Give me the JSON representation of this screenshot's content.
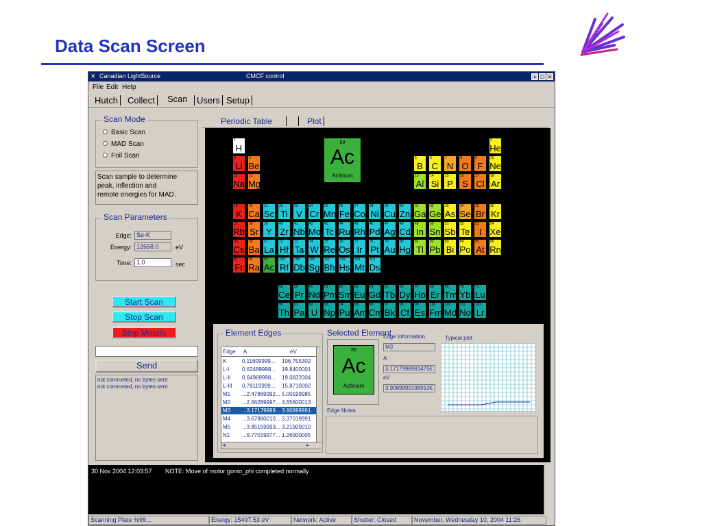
{
  "slide": {
    "title": "Data Scan Screen"
  },
  "window": {
    "app_name": "Canadian LightSource",
    "title": "CMCF control",
    "buttons": [
      "▪",
      "□",
      "×"
    ]
  },
  "menu": [
    "File",
    "Edit",
    "Help"
  ],
  "tabs": [
    "Hutch",
    "Collect",
    "Scan",
    "Users",
    "Setup"
  ],
  "scan_mode": {
    "label": "Scan Mode",
    "options": [
      "Basic Scan",
      "MAD Scan",
      "Foil Scan"
    ],
    "description": [
      "Scan sample to determine",
      "peak, inflection and",
      "remote energies for MAD."
    ]
  },
  "scan_params": {
    "label": "Scan Parameters",
    "edge_label": "Edge:",
    "edge_value": "Se-K",
    "energy_label": "Energy:",
    "energy_value": "12658.0",
    "energy_unit": "eV",
    "time_label": "Time:",
    "time_value": "1.0",
    "time_unit": "sec"
  },
  "actions": {
    "start": "Start Scan",
    "stop": "Stop Scan",
    "stop_motors": "Stop Motors",
    "send": "Send"
  },
  "command_input": "",
  "log": [
    "not connceted, no bytes sent",
    "not connceted, no bytes sent"
  ],
  "periodic_tabs": [
    "Periodic Table",
    "Plot"
  ],
  "selected_big": {
    "number": "89",
    "symbol": "Ac",
    "name": "Actinium"
  },
  "colors": {
    "white": "#ffffff",
    "red": "#e8211a",
    "orange": "#f07a1c",
    "lorange": "#f5a623",
    "yellow": "#f8f01e",
    "lgreen": "#9fe02a",
    "green": "#3cb03c",
    "cyan": "#22c8d8",
    "teal": "#12a8a0",
    "title_blue": "#2233bb"
  },
  "elements": [
    {
      "n": "1",
      "s": "H",
      "c": "white"
    },
    {
      "n": "2",
      "s": "He",
      "c": "yellow"
    },
    {
      "n": "3",
      "s": "Li",
      "c": "red"
    },
    {
      "n": "4",
      "s": "Be",
      "c": "orange"
    },
    {
      "n": "5",
      "s": "B",
      "c": "yellow"
    },
    {
      "n": "6",
      "s": "C",
      "c": "yellow"
    },
    {
      "n": "7",
      "s": "N",
      "c": "lorange"
    },
    {
      "n": "8",
      "s": "O",
      "c": "orange"
    },
    {
      "n": "9",
      "s": "F",
      "c": "orange"
    },
    {
      "n": "10",
      "s": "Ne",
      "c": "yellow"
    },
    {
      "n": "11",
      "s": "Na",
      "c": "red"
    },
    {
      "n": "12",
      "s": "Mg",
      "c": "orange"
    },
    {
      "n": "13",
      "s": "Al",
      "c": "lgreen"
    },
    {
      "n": "14",
      "s": "Si",
      "c": "yellow"
    },
    {
      "n": "15",
      "s": "P",
      "c": "yellow"
    },
    {
      "n": "16",
      "s": "S",
      "c": "orange"
    },
    {
      "n": "17",
      "s": "Cl",
      "c": "orange"
    },
    {
      "n": "18",
      "s": "Ar",
      "c": "yellow"
    },
    {
      "n": "19",
      "s": "K",
      "c": "red"
    },
    {
      "n": "20",
      "s": "Ca",
      "c": "orange"
    },
    {
      "n": "21",
      "s": "Sc",
      "c": "cyan"
    },
    {
      "n": "22",
      "s": "Ti",
      "c": "cyan"
    },
    {
      "n": "23",
      "s": "V",
      "c": "cyan"
    },
    {
      "n": "24",
      "s": "Cr",
      "c": "cyan"
    },
    {
      "n": "25",
      "s": "Mn",
      "c": "cyan"
    },
    {
      "n": "26",
      "s": "Fe",
      "c": "cyan"
    },
    {
      "n": "27",
      "s": "Co",
      "c": "cyan"
    },
    {
      "n": "28",
      "s": "Ni",
      "c": "cyan"
    },
    {
      "n": "29",
      "s": "Cu",
      "c": "cyan"
    },
    {
      "n": "30",
      "s": "Zn",
      "c": "cyan"
    },
    {
      "n": "31",
      "s": "Ga",
      "c": "lgreen"
    },
    {
      "n": "32",
      "s": "Ge",
      "c": "lgreen"
    },
    {
      "n": "33",
      "s": "As",
      "c": "yellow"
    },
    {
      "n": "34",
      "s": "Se",
      "c": "lorange"
    },
    {
      "n": "35",
      "s": "Br",
      "c": "orange"
    },
    {
      "n": "36",
      "s": "Kr",
      "c": "yellow"
    },
    {
      "n": "37",
      "s": "Rb",
      "c": "red"
    },
    {
      "n": "38",
      "s": "Sr",
      "c": "orange"
    },
    {
      "n": "39",
      "s": "Y",
      "c": "cyan"
    },
    {
      "n": "40",
      "s": "Zr",
      "c": "cyan"
    },
    {
      "n": "41",
      "s": "Nb",
      "c": "cyan"
    },
    {
      "n": "42",
      "s": "Mo",
      "c": "cyan"
    },
    {
      "n": "43",
      "s": "Tc",
      "c": "cyan"
    },
    {
      "n": "44",
      "s": "Ru",
      "c": "cyan"
    },
    {
      "n": "45",
      "s": "Rh",
      "c": "cyan"
    },
    {
      "n": "46",
      "s": "Pd",
      "c": "cyan"
    },
    {
      "n": "47",
      "s": "Ag",
      "c": "cyan"
    },
    {
      "n": "48",
      "s": "Cd",
      "c": "cyan"
    },
    {
      "n": "49",
      "s": "In",
      "c": "lgreen"
    },
    {
      "n": "50",
      "s": "Sn",
      "c": "lgreen"
    },
    {
      "n": "51",
      "s": "Sb",
      "c": "yellow"
    },
    {
      "n": "52",
      "s": "Te",
      "c": "yellow"
    },
    {
      "n": "53",
      "s": "I",
      "c": "orange"
    },
    {
      "n": "54",
      "s": "Xe",
      "c": "yellow"
    },
    {
      "n": "55",
      "s": "Cs",
      "c": "red"
    },
    {
      "n": "56",
      "s": "Ba",
      "c": "orange"
    },
    {
      "n": "57",
      "s": "La",
      "c": "cyan"
    },
    {
      "n": "72",
      "s": "Hf",
      "c": "cyan"
    },
    {
      "n": "73",
      "s": "Ta",
      "c": "cyan"
    },
    {
      "n": "74",
      "s": "W",
      "c": "cyan"
    },
    {
      "n": "75",
      "s": "Re",
      "c": "cyan"
    },
    {
      "n": "76",
      "s": "Os",
      "c": "cyan"
    },
    {
      "n": "77",
      "s": "Ir",
      "c": "cyan"
    },
    {
      "n": "78",
      "s": "Pt",
      "c": "cyan"
    },
    {
      "n": "79",
      "s": "Au",
      "c": "cyan"
    },
    {
      "n": "80",
      "s": "Hg",
      "c": "cyan"
    },
    {
      "n": "81",
      "s": "Tl",
      "c": "lgreen"
    },
    {
      "n": "82",
      "s": "Pb",
      "c": "lgreen"
    },
    {
      "n": "83",
      "s": "Bi",
      "c": "yellow"
    },
    {
      "n": "84",
      "s": "Po",
      "c": "yellow"
    },
    {
      "n": "85",
      "s": "At",
      "c": "orange"
    },
    {
      "n": "86",
      "s": "Rn",
      "c": "yellow"
    },
    {
      "n": "87",
      "s": "Fr",
      "c": "red"
    },
    {
      "n": "88",
      "s": "Ra",
      "c": "orange"
    },
    {
      "n": "89",
      "s": "Ac",
      "c": "green"
    },
    {
      "n": "104",
      "s": "Rf",
      "c": "cyan"
    },
    {
      "n": "105",
      "s": "Db",
      "c": "cyan"
    },
    {
      "n": "106",
      "s": "Sg",
      "c": "cyan"
    },
    {
      "n": "107",
      "s": "Bh",
      "c": "cyan"
    },
    {
      "n": "108",
      "s": "Hs",
      "c": "cyan"
    },
    {
      "n": "109",
      "s": "Mt",
      "c": "cyan"
    },
    {
      "n": "110",
      "s": "Ds",
      "c": "cyan"
    },
    {
      "n": "58",
      "s": "Ce",
      "c": "teal"
    },
    {
      "n": "59",
      "s": "Pr",
      "c": "teal"
    },
    {
      "n": "60",
      "s": "Nd",
      "c": "teal"
    },
    {
      "n": "61",
      "s": "Pm",
      "c": "teal"
    },
    {
      "n": "62",
      "s": "Sm",
      "c": "teal"
    },
    {
      "n": "63",
      "s": "Eu",
      "c": "teal"
    },
    {
      "n": "64",
      "s": "Gd",
      "c": "teal"
    },
    {
      "n": "65",
      "s": "Tb",
      "c": "teal"
    },
    {
      "n": "66",
      "s": "Dy",
      "c": "teal"
    },
    {
      "n": "67",
      "s": "Ho",
      "c": "teal"
    },
    {
      "n": "68",
      "s": "Er",
      "c": "teal"
    },
    {
      "n": "69",
      "s": "Tm",
      "c": "teal"
    },
    {
      "n": "70",
      "s": "Yb",
      "c": "teal"
    },
    {
      "n": "71",
      "s": "Lu",
      "c": "teal"
    },
    {
      "n": "90",
      "s": "Th",
      "c": "teal"
    },
    {
      "n": "91",
      "s": "Pa",
      "c": "teal"
    },
    {
      "n": "92",
      "s": "U",
      "c": "teal"
    },
    {
      "n": "93",
      "s": "Np",
      "c": "teal"
    },
    {
      "n": "94",
      "s": "Pu",
      "c": "teal"
    },
    {
      "n": "95",
      "s": "Am",
      "c": "teal"
    },
    {
      "n": "96",
      "s": "Cm",
      "c": "teal"
    },
    {
      "n": "97",
      "s": "Bk",
      "c": "teal"
    },
    {
      "n": "98",
      "s": "Cf",
      "c": "teal"
    },
    {
      "n": "99",
      "s": "Es",
      "c": "teal"
    },
    {
      "n": "100",
      "s": "Fm",
      "c": "teal"
    },
    {
      "n": "101",
      "s": "Md",
      "c": "teal"
    },
    {
      "n": "102",
      "s": "No",
      "c": "teal"
    },
    {
      "n": "103",
      "s": "Lr",
      "c": "teal"
    }
  ],
  "element_edges": {
    "label": "Element Edges",
    "headers": [
      "Edge",
      "A",
      "eV"
    ],
    "rows": [
      [
        "K",
        "0.11609999...",
        "106.755302"
      ],
      [
        "L-I",
        "0.62489998...",
        "19.8400001"
      ],
      [
        "L-II",
        "0.64969998...",
        "19.0832004"
      ],
      [
        "L-III",
        "0.78119999...",
        "15.8710002"
      ],
      [
        "M1",
        "...2.47869992...",
        "5.00199985"
      ],
      [
        "M2",
        "...2.66289997...",
        "4.65600013"
      ],
      [
        "M3",
        "...3.17179989...",
        "3.90899991"
      ],
      [
        "M4",
        "...3.67880010...",
        "3.37019991"
      ],
      [
        "M5",
        "...3.85159993...",
        "3.21900010"
      ],
      [
        "N1",
        "...9.77019977...",
        "1.26900005"
      ]
    ],
    "selected_index": 6
  },
  "selected_element": {
    "label": "Selected Element",
    "number": "89",
    "symbol": "Ac",
    "name": "Actinium",
    "edge_info_label": "Edge Information",
    "edge_value": "M3",
    "a_label": "A",
    "a_value": "3.1717998981475€",
    "ev_label": "eV",
    "ev_value": "3.9089999198913€",
    "notes_label": "Edge Notes"
  },
  "typical_plot_label": "Typical plot",
  "status_message": {
    "time": "30 Nov 2004 12:03:57",
    "text": "NOTE: Move of motor gonio_phi completed normally"
  },
  "statusbar": [
    "Scanning Plate %99...",
    "Energy: 15497.53 eV",
    "Network: Active",
    "Shutter: Closed",
    "November, Wednesday 10, 2004  11:26"
  ]
}
